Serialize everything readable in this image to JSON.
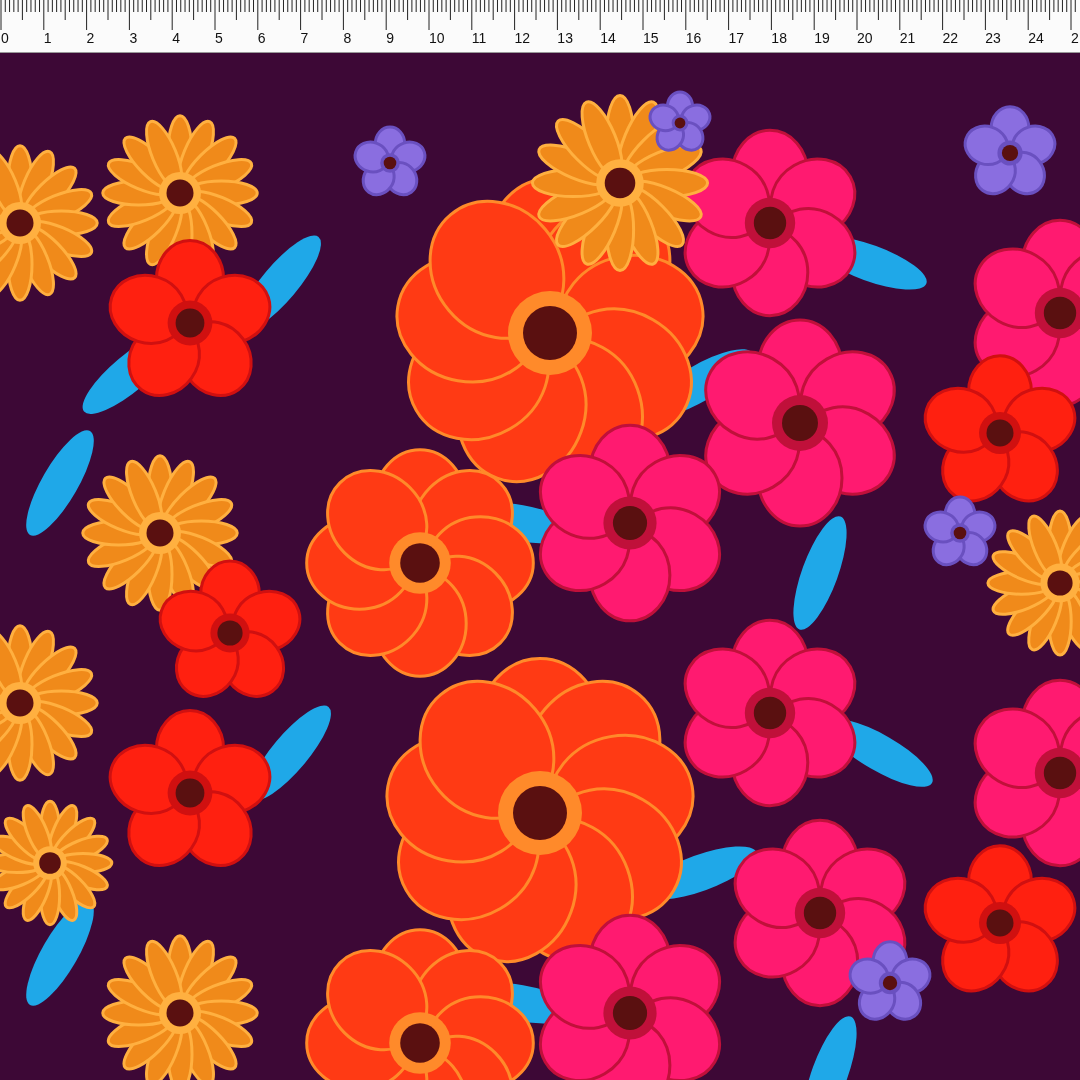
{
  "ruler": {
    "labels": [
      "0",
      "1",
      "2",
      "3",
      "4",
      "5",
      "6",
      "7",
      "8",
      "9",
      "10",
      "11",
      "12",
      "13",
      "14",
      "15",
      "16",
      "17",
      "18",
      "19",
      "20",
      "21",
      "22",
      "23",
      "24",
      "2"
    ]
  }
}
